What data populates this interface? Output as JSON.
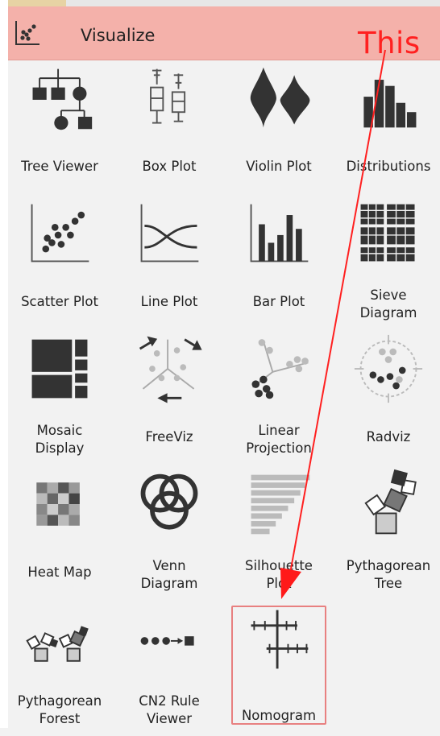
{
  "header": {
    "title": "Visualize",
    "icon": "scatter-plot-icon"
  },
  "annotation": {
    "text": "This",
    "color": "#ff2020"
  },
  "widgets": [
    {
      "name": "tree-viewer",
      "label": "Tree Viewer",
      "icon": "tree-viewer-icon"
    },
    {
      "name": "box-plot",
      "label": "Box Plot",
      "icon": "box-plot-icon"
    },
    {
      "name": "violin-plot",
      "label": "Violin Plot",
      "icon": "violin-plot-icon"
    },
    {
      "name": "distributions",
      "label": "Distributions",
      "icon": "distributions-icon"
    },
    {
      "name": "scatter-plot",
      "label": "Scatter Plot",
      "icon": "scatter-plot-icon"
    },
    {
      "name": "line-plot",
      "label": "Line Plot",
      "icon": "line-plot-icon"
    },
    {
      "name": "bar-plot",
      "label": "Bar Plot",
      "icon": "bar-plot-icon"
    },
    {
      "name": "sieve-diagram",
      "label": "Sieve\nDiagram",
      "icon": "sieve-diagram-icon"
    },
    {
      "name": "mosaic-display",
      "label": "Mosaic\nDisplay",
      "icon": "mosaic-display-icon"
    },
    {
      "name": "freeviz",
      "label": "FreeViz",
      "icon": "freeviz-icon"
    },
    {
      "name": "linear-projection",
      "label": "Linear\nProjection",
      "icon": "linear-projection-icon"
    },
    {
      "name": "radviz",
      "label": "Radviz",
      "icon": "radviz-icon"
    },
    {
      "name": "heat-map",
      "label": "Heat Map",
      "icon": "heat-map-icon"
    },
    {
      "name": "venn-diagram",
      "label": "Venn\nDiagram",
      "icon": "venn-diagram-icon"
    },
    {
      "name": "silhouette-plot",
      "label": "Silhouette\nPlot",
      "icon": "silhouette-plot-icon"
    },
    {
      "name": "pythagorean-tree",
      "label": "Pythagorean\nTree",
      "icon": "pythagorean-tree-icon"
    },
    {
      "name": "pythagorean-forest",
      "label": "Pythagorean\nForest",
      "icon": "pythagorean-forest-icon"
    },
    {
      "name": "cn2-rule-viewer",
      "label": "CN2 Rule\nViewer",
      "icon": "cn2-rule-viewer-icon"
    },
    {
      "name": "nomogram",
      "label": "Nomogram",
      "icon": "nomogram-icon",
      "highlighted": true
    }
  ]
}
